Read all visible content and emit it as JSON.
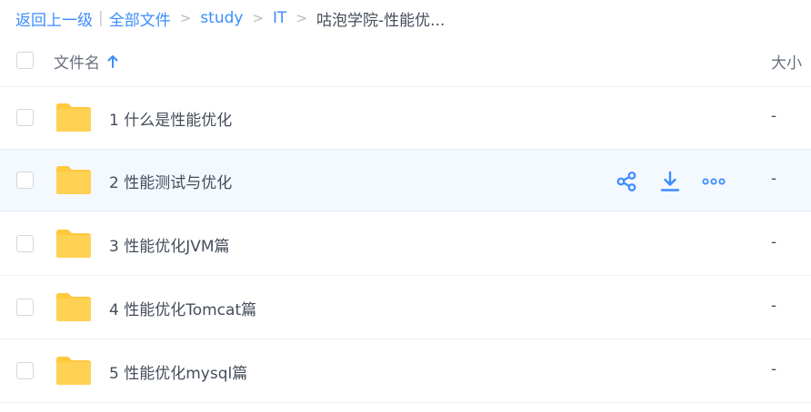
{
  "breadcrumb": {
    "back": "返回上一级",
    "all_files": "全部文件",
    "items": [
      "study",
      "IT"
    ],
    "current": "咕泡学院-性能优...",
    "separator": ">"
  },
  "table": {
    "col_name": "文件名",
    "col_size": "大小",
    "sort": "ascending",
    "rows": [
      {
        "name": "1 什么是性能优化",
        "size": "-",
        "icon": "folder-icon"
      },
      {
        "name": "2 性能测试与优化",
        "size": "-",
        "icon": "folder-icon",
        "hovered": true,
        "actions": [
          "share-icon",
          "download-icon",
          "more-icon"
        ]
      },
      {
        "name": "3 性能优化JVM篇",
        "size": "-",
        "icon": "folder-icon"
      },
      {
        "name": "4 性能优化Tomcat篇",
        "size": "-",
        "icon": "folder-icon"
      },
      {
        "name": "5 性能优化mysql篇",
        "size": "-",
        "icon": "folder-icon"
      }
    ]
  },
  "colors": {
    "accent": "#3b8cff",
    "folder": "#ffd152",
    "hover_bg": "#f4f8ff"
  }
}
